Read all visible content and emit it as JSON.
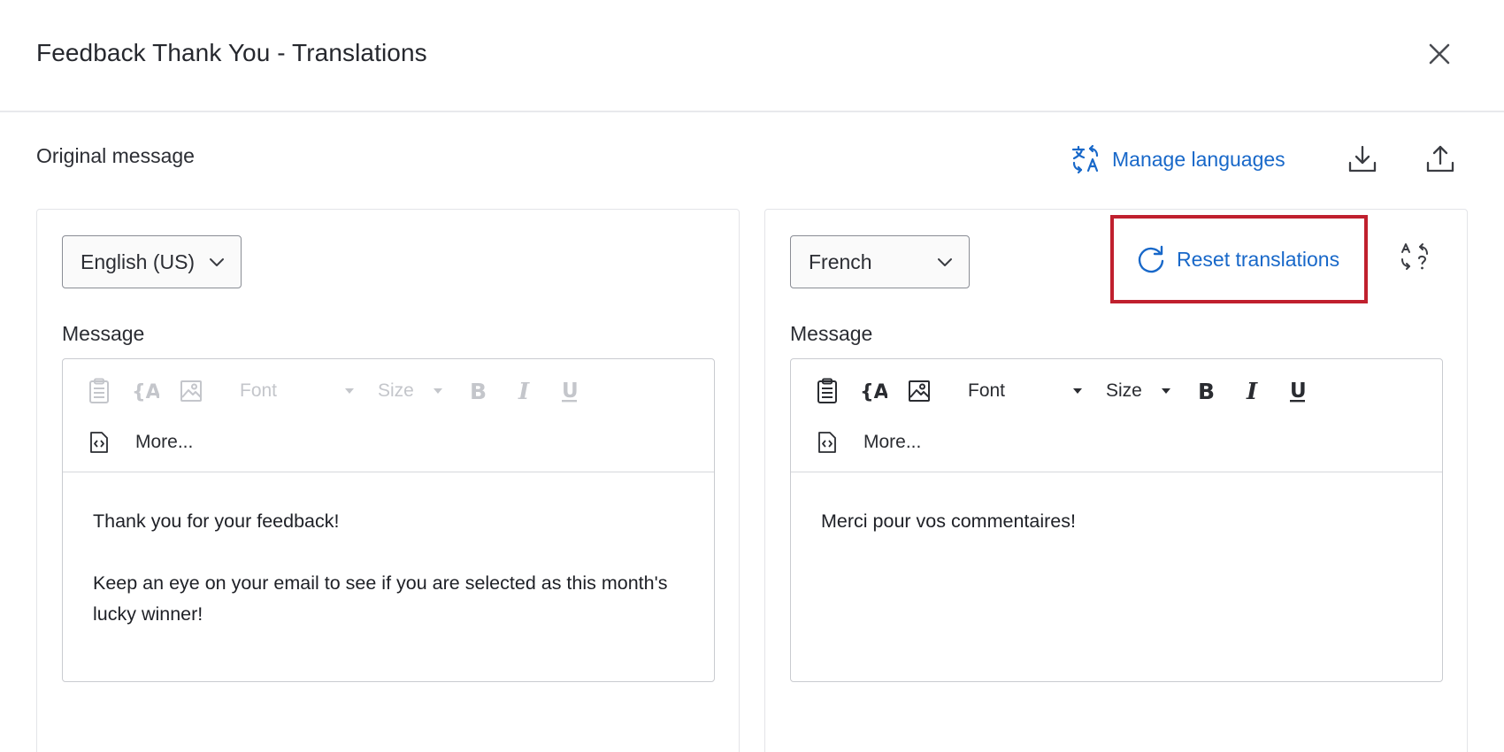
{
  "dialog": {
    "title": "Feedback Thank You - Translations",
    "section_label": "Original message",
    "manage_languages_label": "Manage languages",
    "icons": {
      "close": "close-icon",
      "manage_languages": "translate-icon",
      "download": "download-icon",
      "upload": "upload-icon"
    }
  },
  "colors": {
    "accent": "#1868c9",
    "highlight": "#c0202e",
    "text": "#26282e",
    "disabled": "#c4c6cb"
  },
  "original": {
    "language": "English (US)",
    "message_label": "Message",
    "toolbar": {
      "font_label": "Font",
      "size_label": "Size",
      "more_label": "More...",
      "enabled": false
    },
    "body": [
      "Thank you for your feedback!",
      "Keep an eye on your email to see if you are selected as this month's lucky winner!"
    ]
  },
  "translation": {
    "language": "French",
    "reset_label": "Reset translations",
    "message_label": "Message",
    "toolbar": {
      "font_label": "Font",
      "size_label": "Size",
      "more_label": "More...",
      "enabled": true
    },
    "body": [
      "Merci pour vos commentaires!"
    ]
  }
}
